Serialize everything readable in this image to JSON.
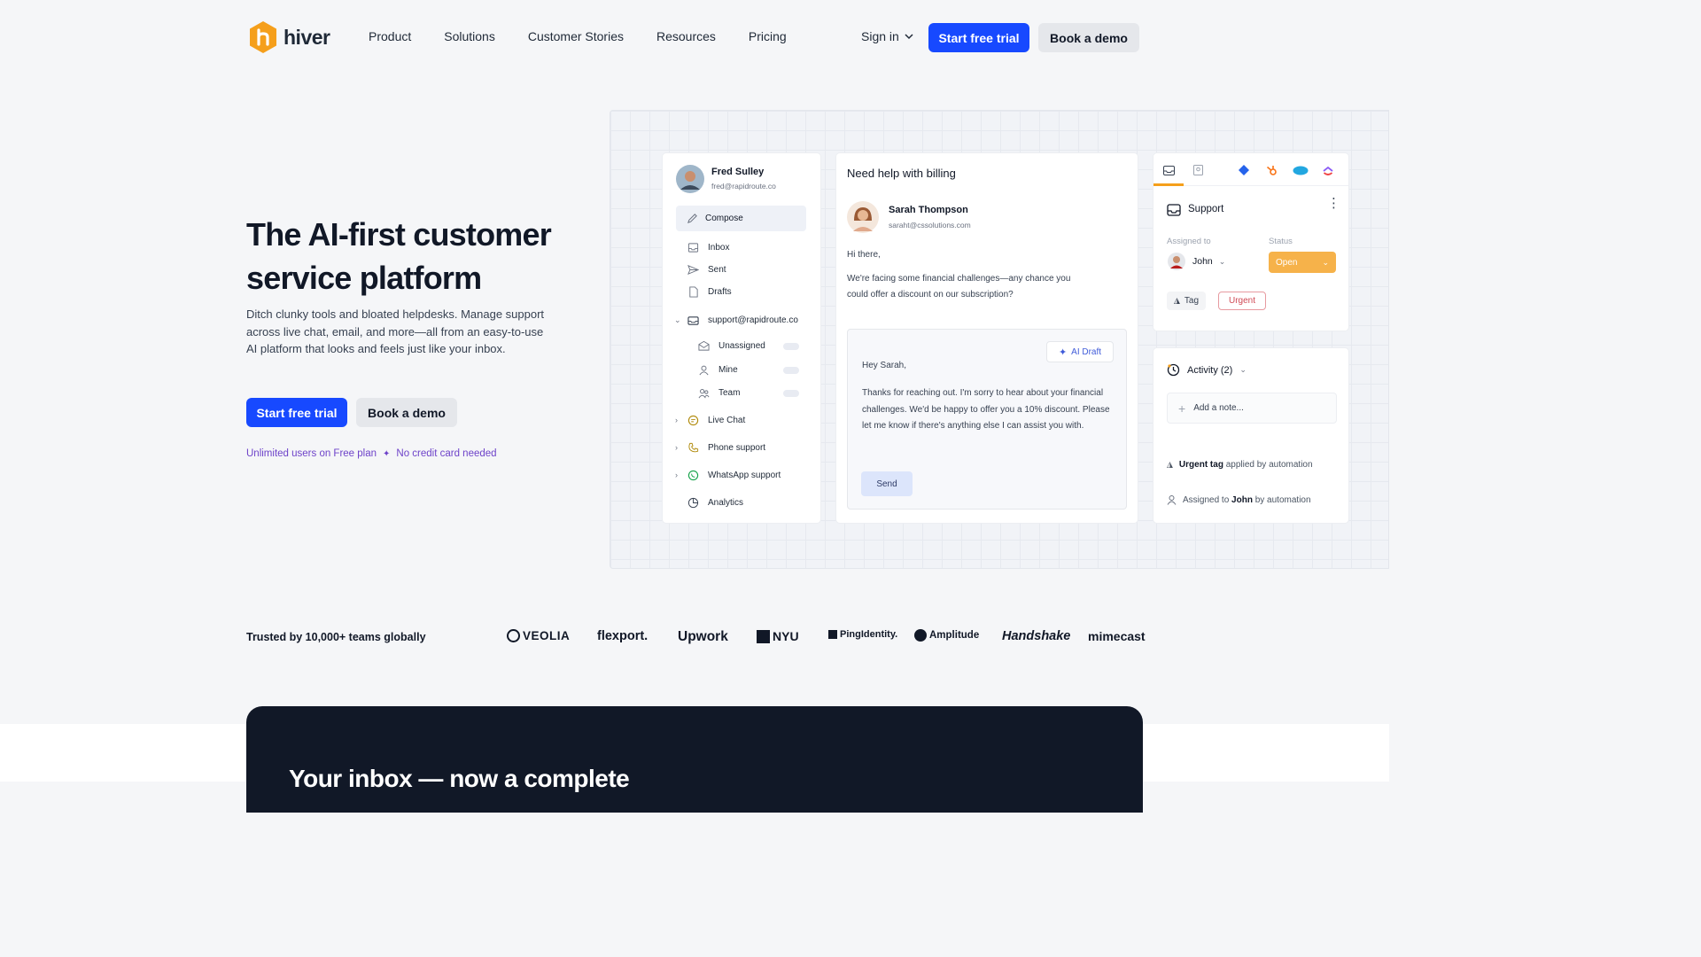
{
  "brand": {
    "name": "hiver",
    "color": "#f59f1b",
    "accent": "#1749ff"
  },
  "nav": {
    "links": [
      "Product",
      "Solutions",
      "Customer Stories",
      "Resources",
      "Pricing"
    ],
    "signin": "Sign in",
    "trial": "Start free trial",
    "demo": "Book a demo"
  },
  "hero": {
    "title": "The AI-first customer service platform",
    "subtitle": "Ditch clunky tools and bloated helpdesks. Manage support across live chat, email, and more—all from an easy-to-use AI platform that looks and feels just like your inbox.",
    "trial": "Start free trial",
    "demo": "Book a demo",
    "note1": "Unlimited users on Free plan",
    "note_sep": "✦",
    "note2": "No credit card needed"
  },
  "mock": {
    "user": {
      "name": "Fred Sulley",
      "email": "fred@rapidroute.co"
    },
    "sidebar": {
      "compose": "Compose",
      "inbox": "Inbox",
      "sent": "Sent",
      "drafts": "Drafts",
      "shared": "support@rapidroute.co",
      "unassigned": "Unassigned",
      "mine": "Mine",
      "team": "Team",
      "livechat": "Live Chat",
      "phone": "Phone support",
      "whatsapp": "WhatsApp support",
      "analytics": "Analytics"
    },
    "email": {
      "subject": "Need help with billing",
      "sender": "Sarah Thompson",
      "sender_email": "saraht@cssolutions.com",
      "greeting": "Hi there,",
      "body": "We're facing some financial challenges—any chance you could offer a discount on our subscription?",
      "ai_draft_label": "AI Draft",
      "reply_greeting": "Hey Sarah,",
      "reply_body": "Thanks for reaching out. I'm sorry to hear about your financial challenges. We'd be happy to offer you a 10% discount. Please let me know if there's anything else I can assist you with.",
      "send": "Send"
    },
    "right": {
      "inbox_name": "Support",
      "assigned_label": "Assigned to",
      "assignee": "John",
      "status_label": "Status",
      "status": "Open",
      "tag": "Tag",
      "urgent": "Urgent",
      "activity": "Activity (2)",
      "note_placeholder": "Add a note...",
      "act1_bold": "Urgent tag",
      "act1_rest": "applied by automation",
      "act2_pre": "Assigned to",
      "act2_bold": "John",
      "act2_rest": "by automation"
    }
  },
  "trusted": {
    "label": "Trusted by 10,000+ teams globally",
    "logos": [
      "VEOLIA",
      "flexport.",
      "Upwork",
      "NYU",
      "PingIdentity.",
      "Amplitude",
      "Handshake",
      "mimecast"
    ]
  },
  "dark": {
    "title": "Your inbox — now a complete"
  }
}
